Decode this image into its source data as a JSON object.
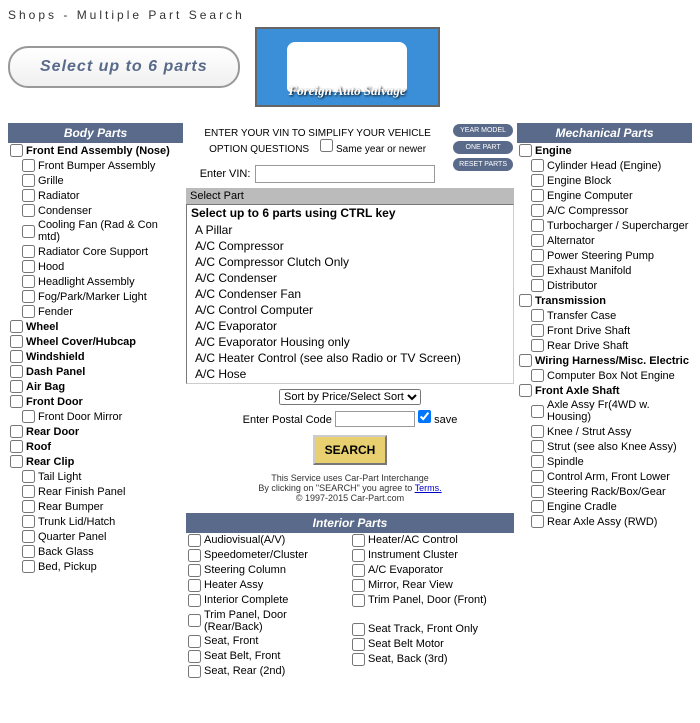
{
  "header": {
    "title": "Shops - Multiple Part Search",
    "subtitle": "Select up to 6 parts",
    "logo_text": "Foreign Auto Salvage"
  },
  "vin_section": {
    "instruction": "ENTER YOUR VIN TO SIMPLIFY YOUR VEHICLE OPTION QUESTIONS",
    "same_year_label": "Same year or newer",
    "enter_vin_label": "Enter VIN:"
  },
  "buttons": {
    "year_model": "YEAR MODEL",
    "one_part": "ONE PART",
    "reset_parts": "RESET PARTS"
  },
  "part_select": {
    "header": "Select Part",
    "instruction": "Select up to 6 parts using CTRL key",
    "options": [
      "A Pillar",
      "A/C Compressor",
      "A/C Compressor Clutch Only",
      "A/C Condenser",
      "A/C Condenser Fan",
      "A/C Control Computer",
      "A/C Evaporator",
      "A/C Evaporator Housing only",
      "A/C Heater Control (see also Radio or TV Screen)",
      "A/C Hose"
    ]
  },
  "sort_label": "Sort by Price/Select Sort",
  "postal": {
    "label": "Enter Postal Code",
    "save_label": "save"
  },
  "search_label": "SEARCH",
  "disclaimer": {
    "line1": "This Service uses Car-Part Interchange",
    "line2a": "By clicking on \"SEARCH\" you agree to ",
    "terms": "Terms.",
    "line3": "© 1997-2015 Car-Part.com"
  },
  "body_parts": {
    "title": "Body Parts",
    "items": [
      {
        "label": "Front End Assembly (Nose)",
        "bold": true,
        "indent": false
      },
      {
        "label": "Front Bumper Assembly",
        "bold": false,
        "indent": true
      },
      {
        "label": "Grille",
        "bold": false,
        "indent": true
      },
      {
        "label": "Radiator",
        "bold": false,
        "indent": true
      },
      {
        "label": "Condenser",
        "bold": false,
        "indent": true
      },
      {
        "label": "Cooling Fan (Rad & Con mtd)",
        "bold": false,
        "indent": true
      },
      {
        "label": "Radiator Core Support",
        "bold": false,
        "indent": true
      },
      {
        "label": "Hood",
        "bold": false,
        "indent": true
      },
      {
        "label": "Headlight Assembly",
        "bold": false,
        "indent": true
      },
      {
        "label": "Fog/Park/Marker Light",
        "bold": false,
        "indent": true
      },
      {
        "label": "Fender",
        "bold": false,
        "indent": true
      },
      {
        "label": "Wheel",
        "bold": true,
        "indent": false
      },
      {
        "label": "Wheel Cover/Hubcap",
        "bold": true,
        "indent": false
      },
      {
        "label": "Windshield",
        "bold": true,
        "indent": false
      },
      {
        "label": "Dash Panel",
        "bold": true,
        "indent": false
      },
      {
        "label": "Air Bag",
        "bold": true,
        "indent": false
      },
      {
        "label": "Front Door",
        "bold": true,
        "indent": false
      },
      {
        "label": "Front Door Mirror",
        "bold": false,
        "indent": true
      },
      {
        "label": "Rear Door",
        "bold": true,
        "indent": false
      },
      {
        "label": "Roof",
        "bold": true,
        "indent": false
      },
      {
        "label": "Rear Clip",
        "bold": true,
        "indent": false
      },
      {
        "label": "Tail Light",
        "bold": false,
        "indent": true
      },
      {
        "label": "Rear Finish Panel",
        "bold": false,
        "indent": true
      },
      {
        "label": "Rear Bumper",
        "bold": false,
        "indent": true
      },
      {
        "label": "Trunk Lid/Hatch",
        "bold": false,
        "indent": true
      },
      {
        "label": "Quarter Panel",
        "bold": false,
        "indent": true
      },
      {
        "label": "Back Glass",
        "bold": false,
        "indent": true
      },
      {
        "label": "Bed, Pickup",
        "bold": false,
        "indent": true
      }
    ]
  },
  "interior_parts": {
    "title": "Interior Parts",
    "col1": [
      "Audiovisual(A/V)",
      "Speedometer/Cluster",
      "Steering Column",
      "Heater Assy",
      "Interior Complete",
      "Trim Panel, Door (Rear/Back)",
      "Seat, Front",
      "Seat Belt, Front",
      "Seat, Rear (2nd)"
    ],
    "col2": [
      "Heater/AC Control",
      "Instrument Cluster",
      "A/C Evaporator",
      "Mirror, Rear View",
      "Trim Panel, Door (Front)",
      "",
      "Seat Track, Front Only",
      "Seat Belt Motor",
      "Seat, Back (3rd)"
    ]
  },
  "mechanical_parts": {
    "title": "Mechanical Parts",
    "items": [
      {
        "label": "Engine",
        "bold": true,
        "indent": false
      },
      {
        "label": "Cylinder Head (Engine)",
        "bold": false,
        "indent": true
      },
      {
        "label": "Engine Block",
        "bold": false,
        "indent": true
      },
      {
        "label": "Engine Computer",
        "bold": false,
        "indent": true
      },
      {
        "label": "A/C Compressor",
        "bold": false,
        "indent": true
      },
      {
        "label": "Turbocharger / Supercharger",
        "bold": false,
        "indent": true
      },
      {
        "label": "Alternator",
        "bold": false,
        "indent": true
      },
      {
        "label": "Power Steering Pump",
        "bold": false,
        "indent": true
      },
      {
        "label": "Exhaust Manifold",
        "bold": false,
        "indent": true
      },
      {
        "label": "Distributor",
        "bold": false,
        "indent": true
      },
      {
        "label": "Transmission",
        "bold": true,
        "indent": false
      },
      {
        "label": "Transfer Case",
        "bold": false,
        "indent": true
      },
      {
        "label": "Front Drive Shaft",
        "bold": false,
        "indent": true
      },
      {
        "label": "Rear Drive Shaft",
        "bold": false,
        "indent": true
      },
      {
        "label": "Wiring Harness/Misc. Electric",
        "bold": true,
        "indent": false
      },
      {
        "label": "Computer Box Not Engine",
        "bold": false,
        "indent": true
      },
      {
        "label": "Front Axle Shaft",
        "bold": true,
        "indent": false
      },
      {
        "label": "Axle Assy Fr(4WD w. Housing)",
        "bold": false,
        "indent": true
      },
      {
        "label": "Knee / Strut Assy",
        "bold": false,
        "indent": true
      },
      {
        "label": "Strut (see also Knee Assy)",
        "bold": false,
        "indent": true
      },
      {
        "label": "Spindle",
        "bold": false,
        "indent": true
      },
      {
        "label": "Control Arm, Front Lower",
        "bold": false,
        "indent": true
      },
      {
        "label": "Steering Rack/Box/Gear",
        "bold": false,
        "indent": true
      },
      {
        "label": "Engine Cradle",
        "bold": false,
        "indent": true
      },
      {
        "label": "Rear Axle Assy (RWD)",
        "bold": false,
        "indent": true
      }
    ]
  }
}
